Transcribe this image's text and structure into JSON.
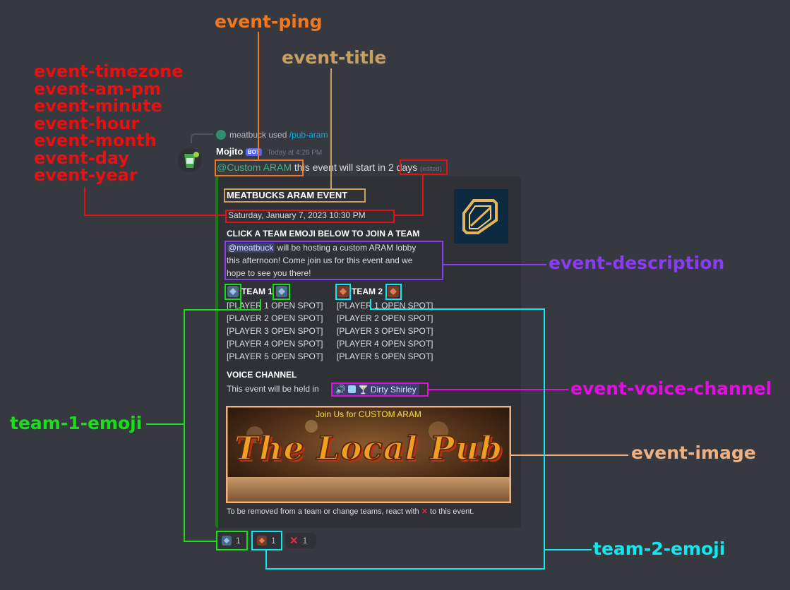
{
  "annotations": {
    "event_ping": "event-ping",
    "event_title": "event-title",
    "date_labels": [
      "event-timezone",
      "event-am-pm",
      "event-minute",
      "event-hour",
      "event-month",
      "event-day",
      "event-year"
    ],
    "event_description": "event-description",
    "event_voice_channel": "event-voice-channel",
    "team_1_emoji": "team-1-emoji",
    "event_image": "event-image",
    "team_2_emoji": "team-2-emoji"
  },
  "colors": {
    "orange": "#f07820",
    "tan": "#c8a060",
    "red": "#e81010",
    "purple": "#8a3cf0",
    "magenta": "#e010e0",
    "green": "#18e018",
    "peach": "#f0b080",
    "cyan": "#10e8f0"
  },
  "reply": {
    "user": "meatbuck",
    "verb": "used",
    "command": "/pub-aram"
  },
  "message": {
    "author": "Mojito",
    "bot_tag": "BOT",
    "timestamp": "Today at 4:28 PM",
    "ping": "@Custom ARAM",
    "text": "this event will start",
    "relative_time": "in 2 days",
    "edited": "(edited)"
  },
  "embed": {
    "title": "MEATBUCKS ARAM EVENT",
    "date": "Saturday, January 7, 2023 10:30 PM",
    "join_heading": "CLICK A TEAM EMOJI BELOW TO JOIN A TEAM",
    "description_mention": "@meatbuck",
    "description_lines": [
      "will be hosting a custom ARAM lobby",
      "this afternoon! Come join us for this event and we",
      "hope to see you there!"
    ],
    "team1": {
      "name": "TEAM 1",
      "players": [
        "[PLAYER 1 OPEN SPOT]",
        "[PLAYER 2 OPEN SPOT]",
        "[PLAYER 3 OPEN SPOT]",
        "[PLAYER 4 OPEN SPOT]",
        "[PLAYER 5 OPEN SPOT]"
      ]
    },
    "team2": {
      "name": "TEAM 2",
      "players": [
        "[PLAYER 1 OPEN SPOT]",
        "[PLAYER 2 OPEN SPOT]",
        "[PLAYER 3 OPEN SPOT]",
        "[PLAYER 4 OPEN SPOT]",
        "[PLAYER 5 OPEN SPOT]"
      ]
    },
    "voice_heading": "VOICE CHANNEL",
    "voice_text": "This event will be held in",
    "voice_channel": "Dirty Shirley",
    "image_caption": "Join Us for CUSTOM ARAM",
    "image_title": "The Local Pub",
    "footer_before": "To be removed from a team or change teams, react with",
    "footer_after": "to this event."
  },
  "reactions": [
    {
      "icon": "team-1-emoji",
      "count": "1"
    },
    {
      "icon": "team-2-emoji",
      "count": "1"
    },
    {
      "icon": "x-emoji",
      "count": "1"
    }
  ]
}
